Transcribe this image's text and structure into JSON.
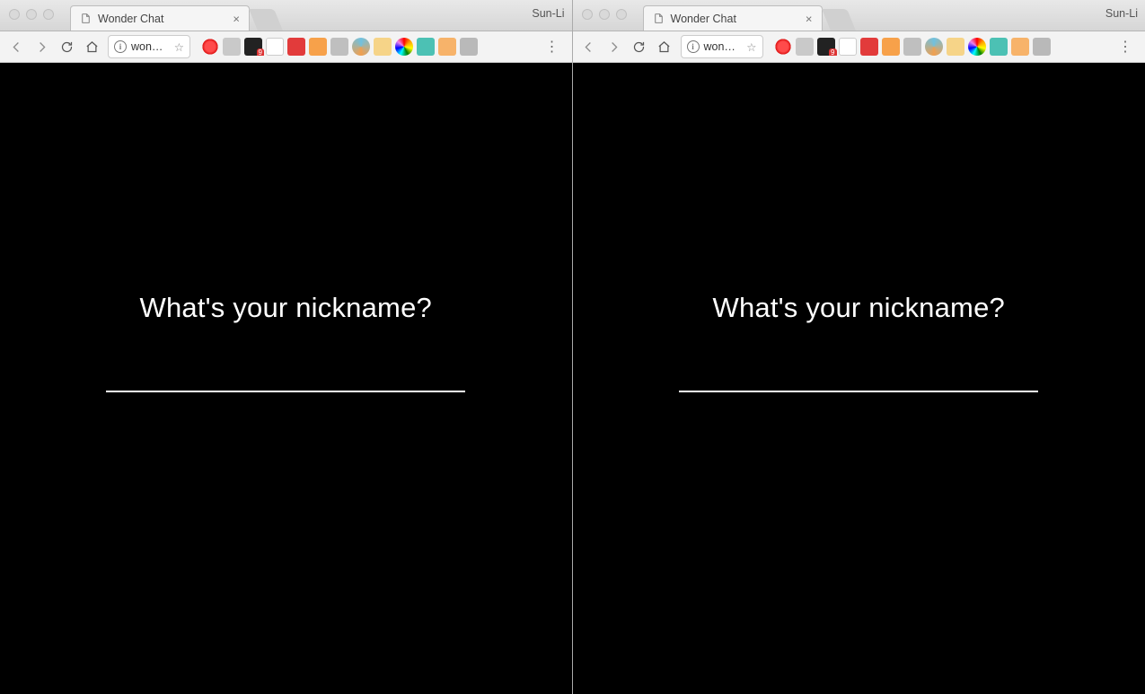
{
  "windows": [
    {
      "profileLabel": "Sun-Li",
      "tab": {
        "title": "Wonder Chat"
      },
      "omnibox": {
        "urlText": "won…"
      },
      "page": {
        "prompt": "What's your nickname?",
        "nicknameValue": "",
        "focused": false
      }
    },
    {
      "profileLabel": "Sun-Li",
      "tab": {
        "title": "Wonder Chat"
      },
      "omnibox": {
        "urlText": "won…"
      },
      "page": {
        "prompt": "What's your nickname?",
        "nicknameValue": "",
        "focused": true
      }
    }
  ],
  "extensionIcons": [
    {
      "name": "opera-icon",
      "cls": "c-opera"
    },
    {
      "name": "extension-icon",
      "cls": "c-gray"
    },
    {
      "name": "amazon-icon",
      "cls": "c-amazon",
      "badge": true
    },
    {
      "name": "extension-icon",
      "cls": "c-blank"
    },
    {
      "name": "lastpass-icon",
      "cls": "c-red"
    },
    {
      "name": "extension-icon",
      "cls": "c-orange"
    },
    {
      "name": "skype-icon",
      "cls": "c-skype"
    },
    {
      "name": "globe-icon",
      "cls": "c-globe"
    },
    {
      "name": "flag-icon",
      "cls": "c-flag"
    },
    {
      "name": "colorpicker-icon",
      "cls": "c-color"
    },
    {
      "name": "extension-icon",
      "cls": "c-teal"
    },
    {
      "name": "extension-icon",
      "cls": "c-swoosh"
    },
    {
      "name": "extension-icon",
      "cls": "c-gray2"
    }
  ]
}
